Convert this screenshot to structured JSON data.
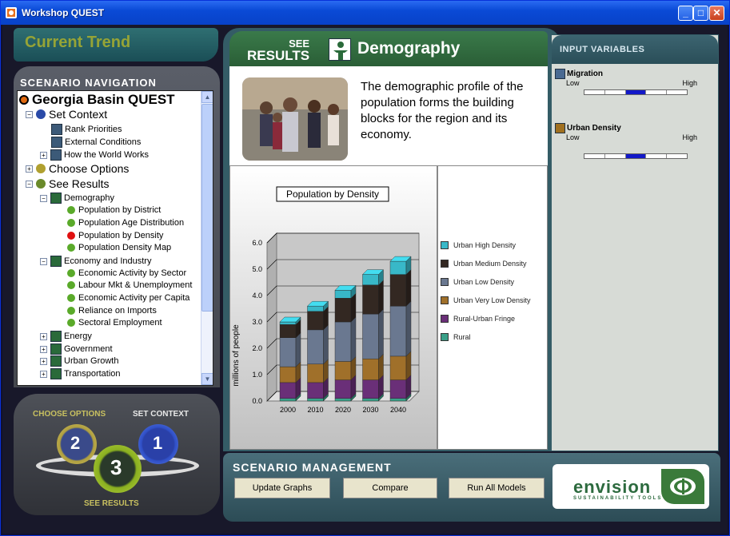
{
  "window": {
    "title": "Workshop QUEST"
  },
  "current_trend": "Current Trend",
  "nav": {
    "title": "SCENARIO NAVIGATION",
    "root": "Georgia Basin QUEST",
    "set_context": "Set Context",
    "set_context_items": [
      "Rank Priorities",
      "External Conditions",
      "How the World Works"
    ],
    "choose_options": "Choose Options",
    "see_results": "See Results",
    "demography": "Demography",
    "demography_items": [
      {
        "label": "Population by District",
        "status": "green"
      },
      {
        "label": "Population Age Distribution",
        "status": "green"
      },
      {
        "label": "Population by Density",
        "status": "red"
      },
      {
        "label": "Population Density Map",
        "status": "green"
      }
    ],
    "economy": "Economy and Industry",
    "economy_items": [
      "Economic Activity by Sector",
      "Labour Mkt & Unemployment",
      "Economic Activity per Capita",
      "Reliance on Imports",
      "Sectoral Employment"
    ],
    "other_groups": [
      "Energy",
      "Government",
      "Urban Growth",
      "Transportation"
    ]
  },
  "steps": {
    "choose": "CHOOSE OPTIONS",
    "context": "SET CONTEXT",
    "results": "SEE RESULTS",
    "n1": "1",
    "n2": "2",
    "n3": "3"
  },
  "results": {
    "see": "SEE",
    "results": "RESULTS",
    "section": "Demography",
    "description": "The demographic profile of the population forms the building blocks for the region and its economy."
  },
  "chart_data": {
    "type": "bar",
    "stacked": true,
    "title": "Population by Density",
    "xlabel": "",
    "ylabel": "millions of people",
    "categories": [
      "2000",
      "2010",
      "2020",
      "2030",
      "2040"
    ],
    "ylim": [
      0,
      6.0
    ],
    "yticks": [
      "0.0",
      "1.0",
      "2.0",
      "3.0",
      "4.0",
      "5.0",
      "6.0"
    ],
    "series": [
      {
        "name": "Rural",
        "color": "#3aa088",
        "values": [
          0.1,
          0.1,
          0.1,
          0.1,
          0.1
        ]
      },
      {
        "name": "Rural-Urban Fringe",
        "color": "#6a2f78",
        "values": [
          0.6,
          0.6,
          0.7,
          0.7,
          0.7
        ]
      },
      {
        "name": "Urban Very Low Density",
        "color": "#a0702a",
        "values": [
          0.6,
          0.7,
          0.7,
          0.8,
          0.9
        ]
      },
      {
        "name": "Urban Low Density",
        "color": "#6a7890",
        "values": [
          1.1,
          1.3,
          1.5,
          1.7,
          1.9
        ]
      },
      {
        "name": "Urban Medium Density",
        "color": "#332822",
        "values": [
          0.5,
          0.7,
          0.9,
          1.1,
          1.2
        ]
      },
      {
        "name": "Urban High Density",
        "color": "#38b8c8",
        "values": [
          0.1,
          0.2,
          0.3,
          0.4,
          0.5
        ]
      }
    ],
    "grid": true,
    "legend": "right"
  },
  "inputs": {
    "title": "INPUT VARIABLES",
    "variables": [
      {
        "name": "Migration",
        "low": "Low",
        "high": "High",
        "segments": 5,
        "selected": 3
      },
      {
        "name": "Urban Density",
        "low": "Low",
        "high": "High",
        "segments": 5,
        "selected": 3
      }
    ]
  },
  "management": {
    "title": "SCENARIO MANAGEMENT",
    "update": "Update Graphs",
    "compare": "Compare",
    "run_all": "Run All Models",
    "brand": "envision",
    "brand_sub": "SUSTAINABILITY TOOLS"
  }
}
